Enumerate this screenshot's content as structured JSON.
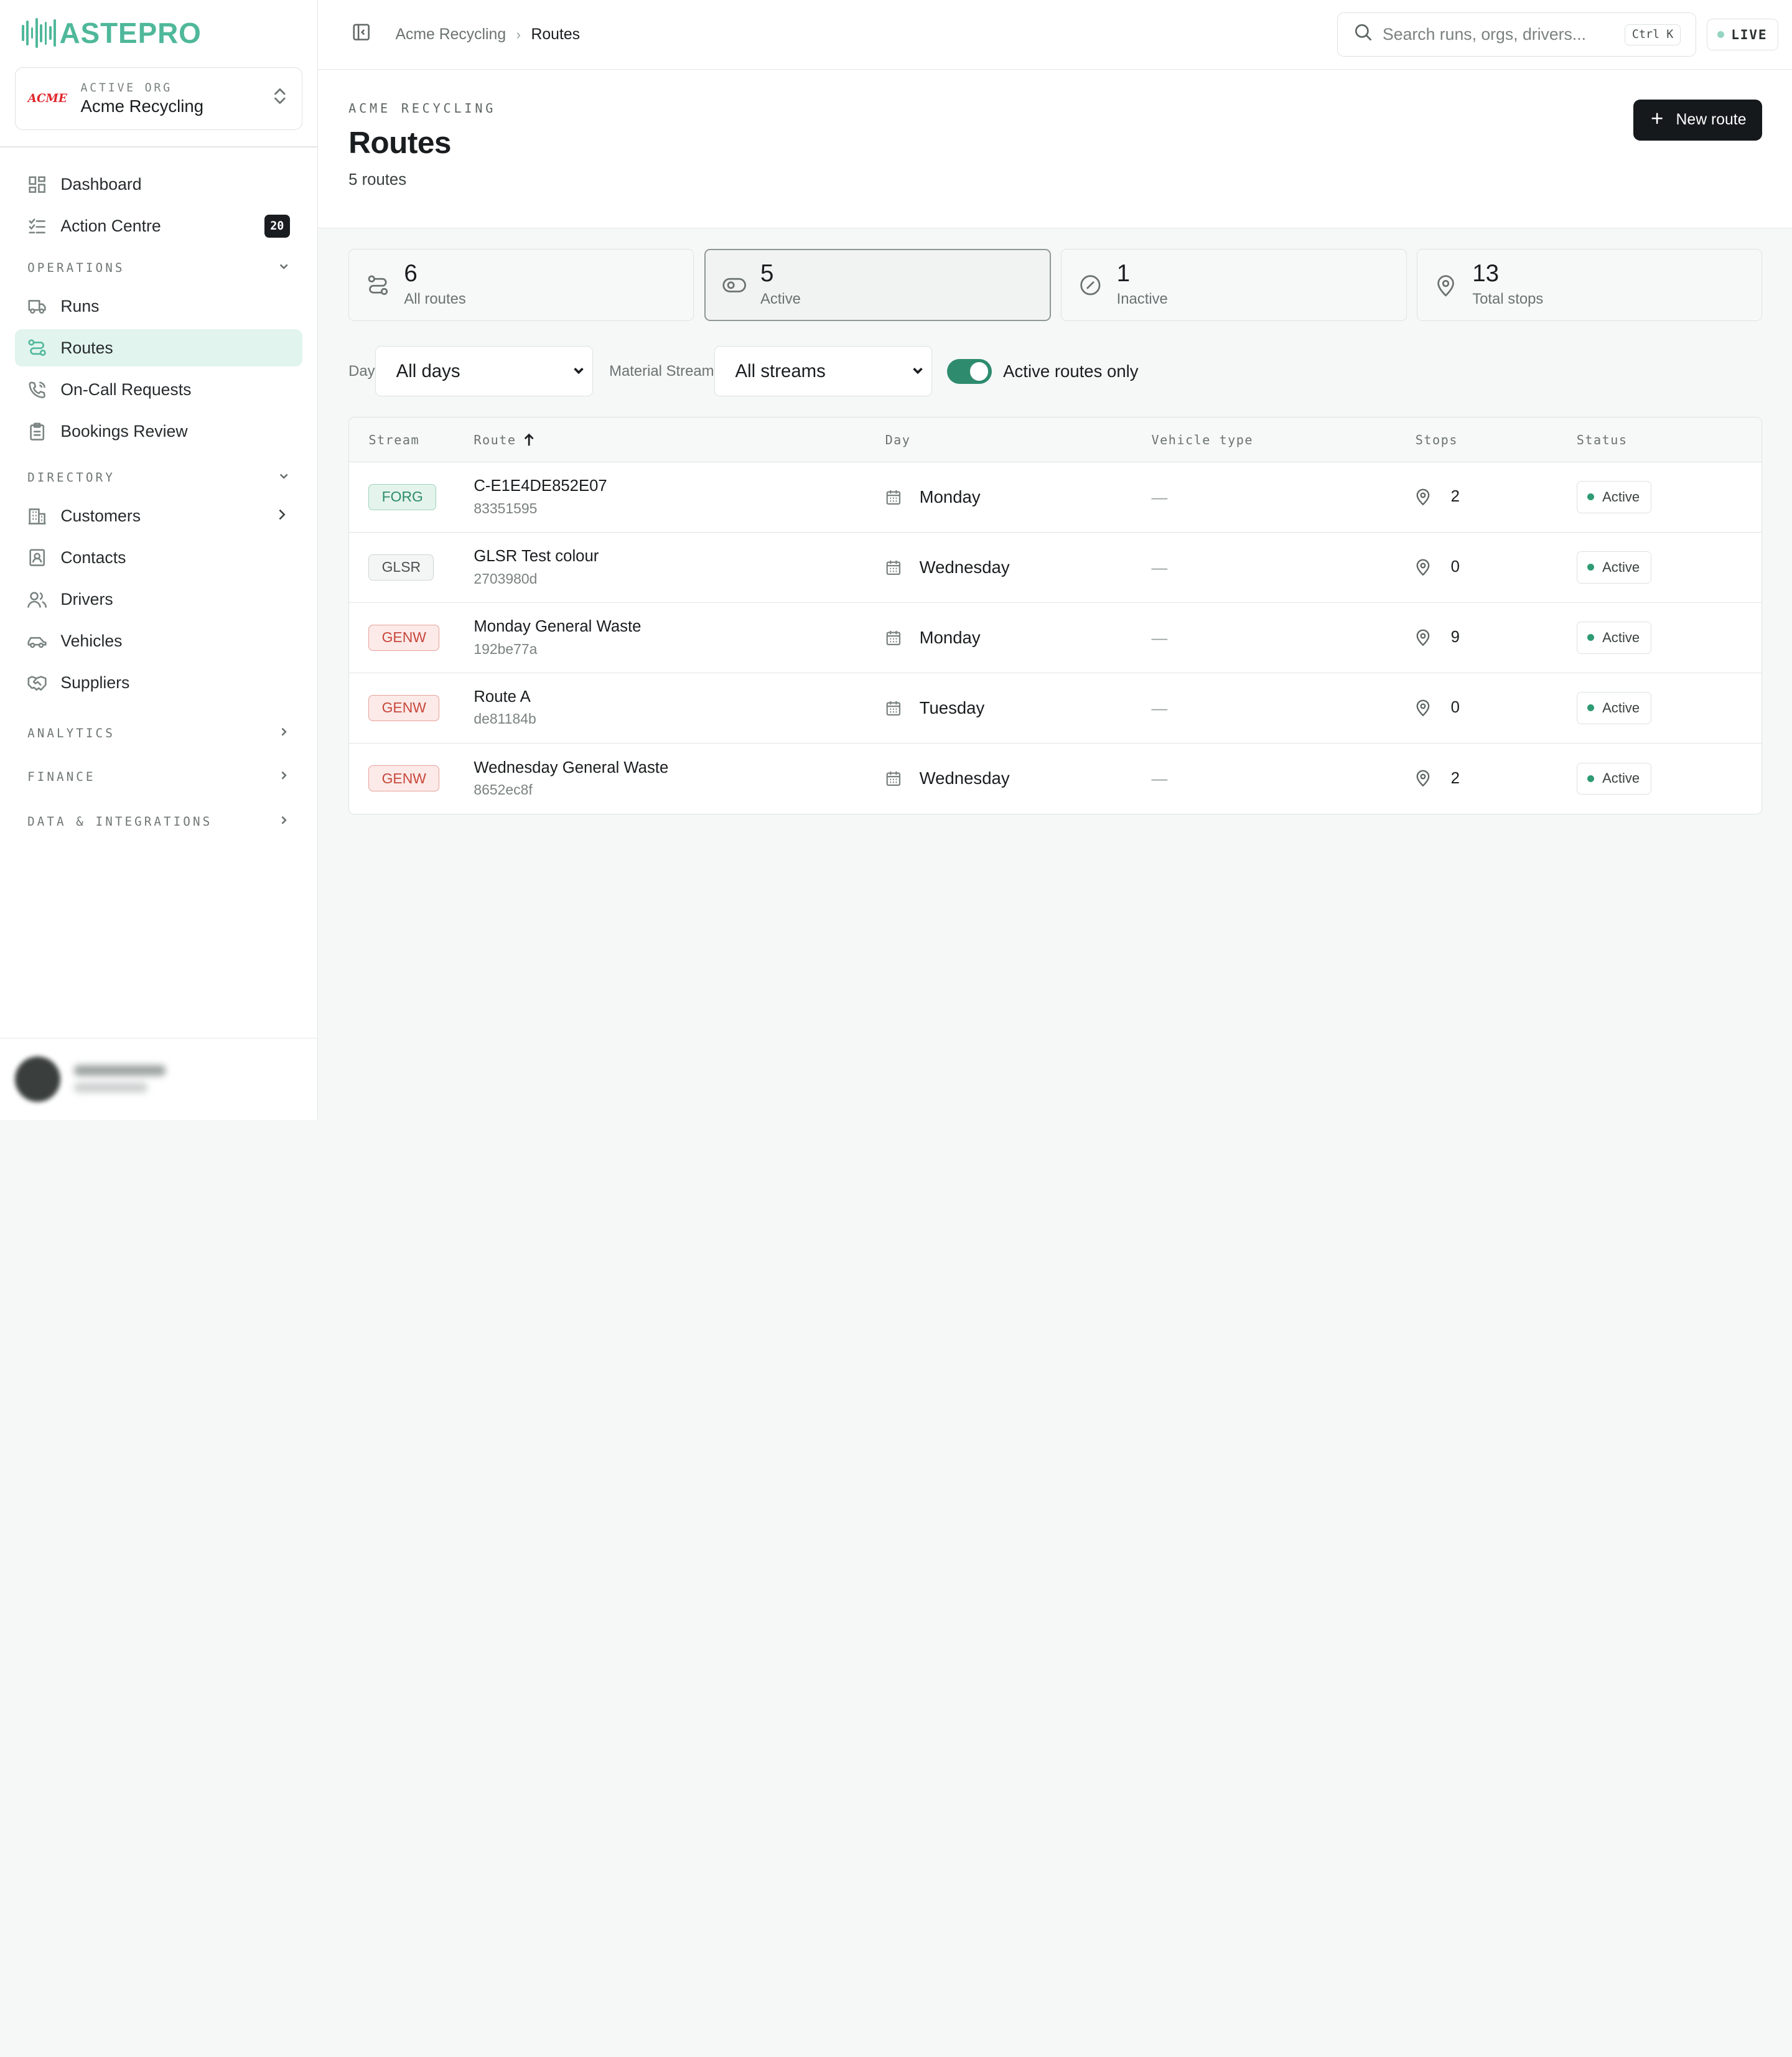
{
  "brand": {
    "name": "ASTEPRO",
    "accent": "#4fb89a"
  },
  "org": {
    "label": "ACTIVE ORG",
    "name": "Acme Recycling",
    "logo_text": "ACME"
  },
  "nav": {
    "dashboard": "Dashboard",
    "action_centre": "Action Centre",
    "action_centre_badge": "20",
    "operations": "OPERATIONS",
    "runs": "Runs",
    "routes": "Routes",
    "on_call": "On-Call Requests",
    "bookings": "Bookings Review",
    "directory": "DIRECTORY",
    "customers": "Customers",
    "contacts": "Contacts",
    "drivers": "Drivers",
    "vehicles": "Vehicles",
    "suppliers": "Suppliers",
    "analytics": "ANALYTICS",
    "finance": "FINANCE",
    "data": "DATA & INTEGRATIONS"
  },
  "topbar": {
    "crumb_org": "Acme Recycling",
    "crumb_page": "Routes",
    "search_placeholder": "Search runs, orgs, drivers...",
    "shortcut": "Ctrl K",
    "live": "LIVE"
  },
  "header": {
    "eyebrow": "ACME RECYCLING",
    "title": "Routes",
    "subtitle": "5 routes",
    "new_button": "New route"
  },
  "stats": [
    {
      "num": "6",
      "label": "All routes",
      "icon": "route-icon"
    },
    {
      "num": "5",
      "label": "Active",
      "icon": "eye-icon"
    },
    {
      "num": "1",
      "label": "Inactive",
      "icon": "slash-circle-icon"
    },
    {
      "num": "13",
      "label": "Total stops",
      "icon": "map-pin-icon"
    }
  ],
  "filters": {
    "day_label": "Day",
    "day_value": "All days",
    "stream_label": "Material Stream",
    "stream_value": "All streams",
    "toggle_label": "Active routes only",
    "toggle_on": true
  },
  "table": {
    "headers": {
      "stream": "Stream",
      "route": "Route",
      "day": "Day",
      "vehicle": "Vehicle type",
      "stops": "Stops",
      "status": "Status"
    },
    "sort": "route-ascending",
    "rows": [
      {
        "stream": "FORG",
        "name": "C-E1E4DE852E07",
        "id": "83351595",
        "day": "Monday",
        "vehicle": "—",
        "stops": "2",
        "status": "Active",
        "color": "#2e8b6e"
      },
      {
        "stream": "GLSR",
        "name": "GLSR Test colour",
        "id": "2703980d",
        "day": "Wednesday",
        "vehicle": "—",
        "stops": "0",
        "status": "Active",
        "color": "#4a5150"
      },
      {
        "stream": "GENW",
        "name": "Monday General Waste",
        "id": "192be77a",
        "day": "Monday",
        "vehicle": "—",
        "stops": "9",
        "status": "Active",
        "color": "#c9473d"
      },
      {
        "stream": "GENW",
        "name": "Route A",
        "id": "de81184b",
        "day": "Tuesday",
        "vehicle": "—",
        "stops": "0",
        "status": "Active",
        "color": "#c9473d"
      },
      {
        "stream": "GENW",
        "name": "Wednesday General Waste",
        "id": "8652ec8f",
        "day": "Wednesday",
        "vehicle": "—",
        "stops": "2",
        "status": "Active",
        "color": "#c9473d"
      }
    ]
  }
}
